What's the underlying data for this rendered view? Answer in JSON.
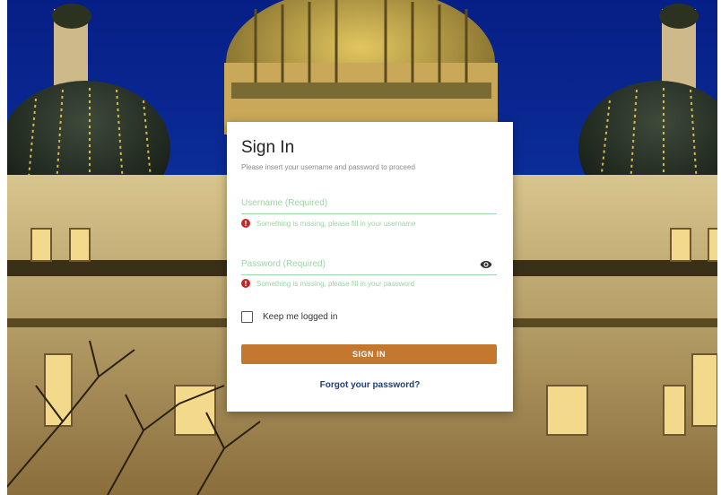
{
  "signin": {
    "title": "Sign In",
    "subtitle": "Please insert your username and password to proceed",
    "username": {
      "placeholder": "Username (Required)",
      "value": "",
      "error": "Something is missing, please fill in your username"
    },
    "password": {
      "placeholder": "Password (Required)",
      "value": "",
      "error": "Something is missing, please fill in your password"
    },
    "remember_label": "Keep me logged in",
    "remember_checked": false,
    "submit_label": "SIGN IN",
    "forgot_label": "Forgot your password?"
  },
  "icons": {
    "error": "error-icon",
    "visibility": "eye-icon",
    "checkbox": "checkbox-icon"
  },
  "colors": {
    "accent_button": "#c4772f",
    "link": "#1d3f7a",
    "validation": "#9fd2a5",
    "error_dot": "#c62828",
    "sky": "#0a2fa0"
  }
}
